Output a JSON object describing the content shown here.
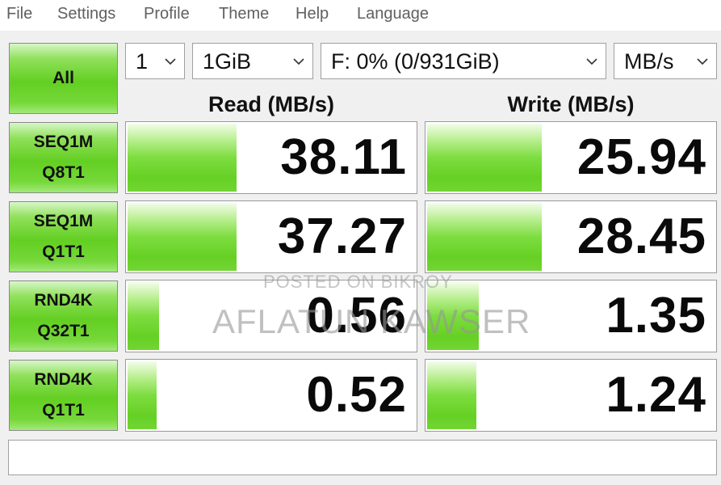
{
  "menu": [
    "File",
    "Settings",
    "Profile",
    "Theme",
    "Help",
    "Language"
  ],
  "all_button": "All",
  "selects": {
    "count": "1",
    "size": "1GiB",
    "drive": "F: 0% (0/931GiB)",
    "unit": "MB/s"
  },
  "headers": {
    "read": "Read (MB/s)",
    "write": "Write (MB/s)"
  },
  "tests": [
    {
      "line1": "SEQ1M",
      "line2": "Q8T1",
      "read": "38.11",
      "write": "25.94",
      "read_fill": 0.38,
      "write_fill": 0.4
    },
    {
      "line1": "SEQ1M",
      "line2": "Q1T1",
      "read": "37.27",
      "write": "28.45",
      "read_fill": 0.38,
      "write_fill": 0.4
    },
    {
      "line1": "RND4K",
      "line2": "Q32T1",
      "read": "0.56",
      "write": "1.35",
      "read_fill": 0.11,
      "write_fill": 0.18
    },
    {
      "line1": "RND4K",
      "line2": "Q1T1",
      "read": "0.52",
      "write": "1.24",
      "read_fill": 0.1,
      "write_fill": 0.17
    }
  ],
  "watermark": {
    "line1": "POSTED ON BIKROY",
    "line2": "AFLATUN KAWSER"
  },
  "colors": {
    "accent_green": "#63cf22",
    "cell_border": "#9a9a9a"
  }
}
